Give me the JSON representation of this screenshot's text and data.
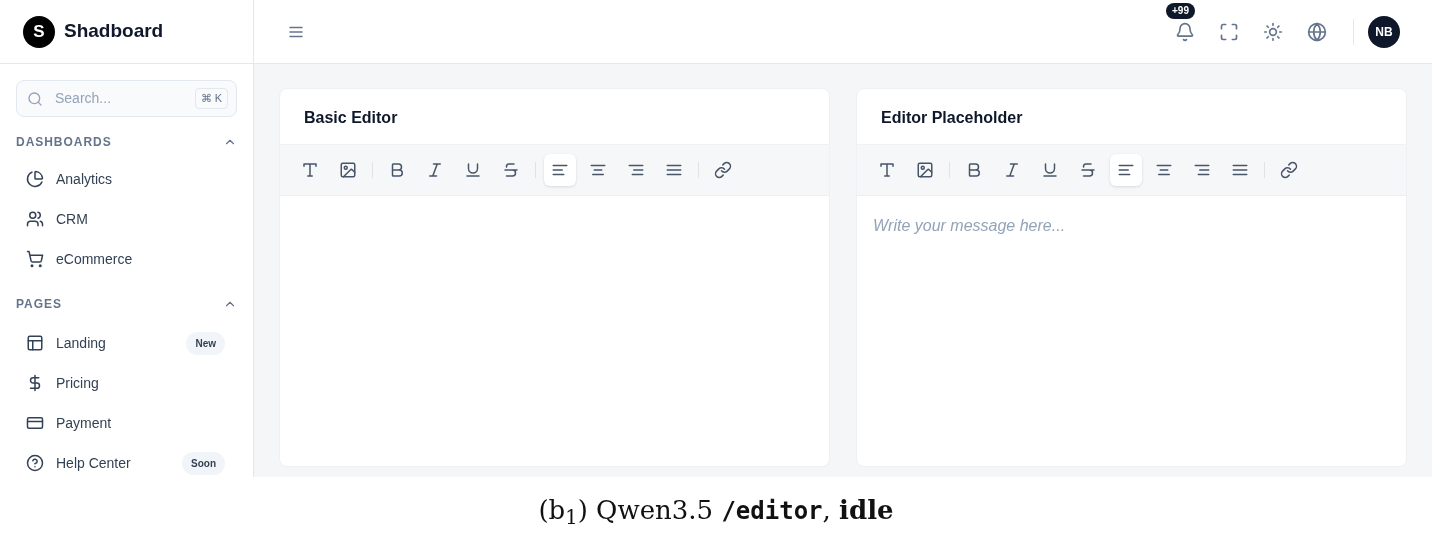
{
  "brand": {
    "logo": "S",
    "name": "Shadboard"
  },
  "search": {
    "placeholder": "Search...",
    "shortcut": "⌘ K"
  },
  "sidebar": {
    "sections": [
      {
        "title": "DASHBOARDS",
        "expanded": true,
        "items": [
          {
            "label": "Analytics",
            "selected": false
          },
          {
            "label": "CRM",
            "selected": false
          },
          {
            "label": "eCommerce",
            "selected": false
          }
        ]
      },
      {
        "title": "PAGES",
        "expanded": true,
        "items": [
          {
            "label": "Landing",
            "badge": "New",
            "selected": false
          },
          {
            "label": "Pricing",
            "selected": false
          },
          {
            "label": "Payment",
            "selected": false
          },
          {
            "label": "Help Center",
            "badge": "Soon",
            "selected": false
          }
        ]
      }
    ]
  },
  "header": {
    "notifications": "+99",
    "avatar": "NB"
  },
  "editors": [
    {
      "title": "Basic Editor",
      "toolbar": [
        {
          "kind": "tool",
          "selected": false
        },
        {
          "kind": "tool",
          "selected": false
        },
        {
          "kind": "divider"
        },
        {
          "kind": "tool",
          "selected": false
        },
        {
          "kind": "tool",
          "selected": false
        },
        {
          "kind": "tool",
          "selected": false
        },
        {
          "kind": "tool",
          "selected": false
        },
        {
          "kind": "divider"
        },
        {
          "kind": "tool",
          "selected": true
        },
        {
          "kind": "tool",
          "selected": false
        },
        {
          "kind": "tool",
          "selected": false
        },
        {
          "kind": "tool",
          "selected": false
        },
        {
          "kind": "divider"
        },
        {
          "kind": "tool",
          "selected": false
        }
      ]
    },
    {
      "title": "Editor Placeholder",
      "placeholder": "Write your message here...",
      "toolbar": [
        {
          "kind": "tool",
          "selected": false
        },
        {
          "kind": "tool",
          "selected": false
        },
        {
          "kind": "divider"
        },
        {
          "kind": "tool",
          "selected": false
        },
        {
          "kind": "tool",
          "selected": false
        },
        {
          "kind": "tool",
          "selected": false
        },
        {
          "kind": "tool",
          "selected": false
        },
        {
          "kind": "tool",
          "selected": true
        },
        {
          "kind": "tool",
          "selected": false
        },
        {
          "kind": "tool",
          "selected": false
        },
        {
          "kind": "tool",
          "selected": false
        },
        {
          "kind": "divider"
        },
        {
          "kind": "tool",
          "selected": false
        }
      ]
    }
  ],
  "caption": {
    "prefix": "(b$_{1}$) Qwen3.5 ",
    "path": "/editor",
    "suffix": ", **idle**"
  }
}
